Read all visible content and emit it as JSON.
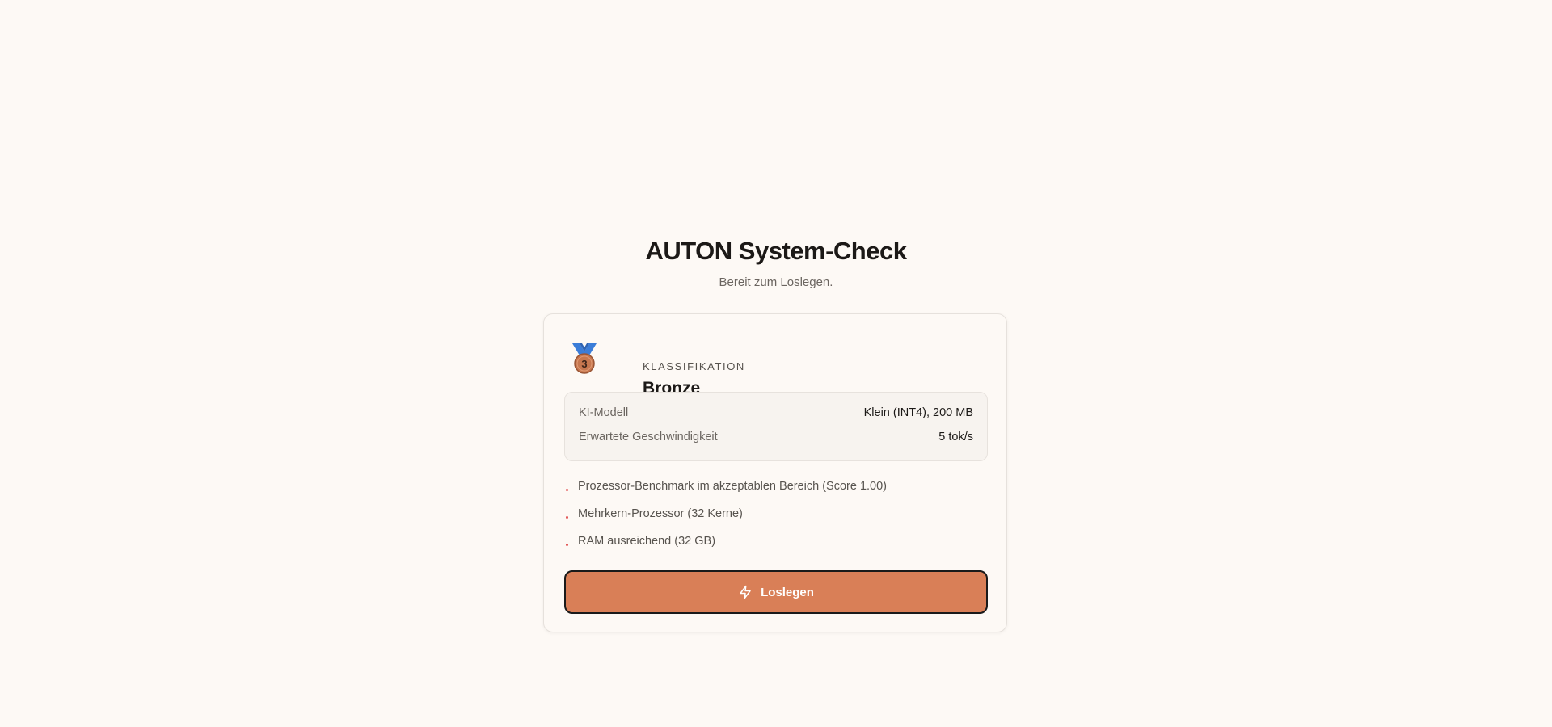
{
  "header": {
    "title": "AUTON System-Check",
    "subtitle": "Bereit zum Loslegen."
  },
  "classification": {
    "label": "Klassifikation",
    "value": "Bronze",
    "medal_number": "3",
    "medal_icon": "bronze-medal-icon"
  },
  "specs": [
    {
      "key": "KI-Modell",
      "value": "Klein (INT4), 200 MB"
    },
    {
      "key": "Erwartete Geschwindigkeit",
      "value": "5 tok/s"
    }
  ],
  "reasons": [
    "Prozessor-Benchmark im akzeptablen Bereich (Score 1.00)",
    "Mehrkern-Prozessor (32 Kerne)",
    "RAM ausreichend (32 GB)"
  ],
  "cta": {
    "label": "Loslegen",
    "icon": "lightning-bolt-icon"
  },
  "colors": {
    "background": "#fdf9f5",
    "accent": "#d97f57",
    "medal_ribbon": "#3b7dd8",
    "medal": "#c7774f",
    "bullet": "#e25555"
  }
}
